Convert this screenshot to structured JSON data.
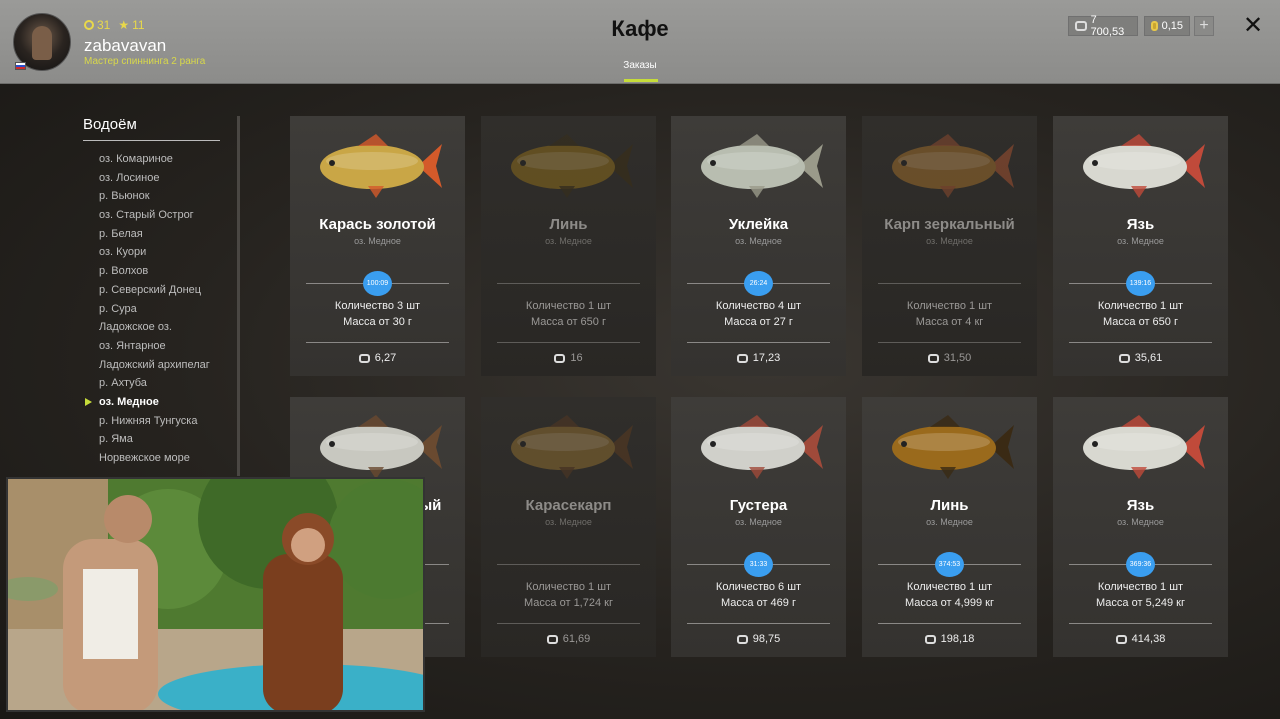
{
  "header": {
    "title": "Кафе",
    "tab": "Заказы",
    "user": {
      "name": "zabavavan",
      "rank": "Мастер спиннинга 2 ранга",
      "level": "31",
      "stars": "11"
    },
    "currency": {
      "silver": "7 700,53",
      "gold": "0,15"
    },
    "plus": "+",
    "close": "✕"
  },
  "sidebar": {
    "title": "Водоём",
    "items": [
      "оз. Комариное",
      "оз. Лосиное",
      "р. Вьюнок",
      "оз. Старый Острог",
      "р. Белая",
      "оз. Куори",
      "р. Волхов",
      "р. Северский Донец",
      "р. Сура",
      "Ладожское оз.",
      "оз. Янтарное",
      "Ладожский архипелаг",
      "р. Ахтуба",
      "оз. Медное",
      "р. Нижняя Тунгуска",
      "р. Яма",
      "Норвежское море"
    ],
    "active_index": 13
  },
  "cards": [
    {
      "name": "Карась золотой",
      "location": "оз. Медное",
      "timer": "100:09",
      "quantity": "Количество 3 шт",
      "mass": "Масса от 30 г",
      "price": "6,27",
      "dim": false,
      "color": "#c9a646",
      "tail": "#d45a2a"
    },
    {
      "name": "Линь",
      "location": "оз. Медное",
      "timer": "",
      "quantity": "Количество 1 шт",
      "mass": "Масса от 650 г",
      "price": "16",
      "dim": true,
      "color": "#8a6a1c",
      "tail": "#3a2e16"
    },
    {
      "name": "Уклейка",
      "location": "оз. Медное",
      "timer": "26:24",
      "quantity": "Количество 4 шт",
      "mass": "Масса от 27 г",
      "price": "17,23",
      "dim": false,
      "color": "#b8bdb0",
      "tail": "#9a9a8a"
    },
    {
      "name": "Карп зеркальный",
      "location": "оз. Медное",
      "timer": "",
      "quantity": "Количество 1 шт",
      "mass": "Масса от 4 кг",
      "price": "31,50",
      "dim": true,
      "color": "#9a6a2a",
      "tail": "#a05030"
    },
    {
      "name": "Язь",
      "location": "оз. Медное",
      "timer": "139:16",
      "quantity": "Количество 1 шт",
      "mass": "Масса от 650 г",
      "price": "35,61",
      "dim": false,
      "color": "#d8d8d0",
      "tail": "#c04a3a"
    },
    {
      "name": "Лещ серебряный",
      "location": "оз. Медное",
      "timer": "",
      "quantity": "",
      "mass": "",
      "price": "",
      "dim": false,
      "color": "#c8c8c0",
      "tail": "#6a4a30"
    },
    {
      "name": "Карасекарп",
      "location": "оз. Медное",
      "timer": "",
      "quantity": "Количество 1 шт",
      "mass": "Масса от 1,724 кг",
      "price": "61,69",
      "dim": true,
      "color": "#8a6a30",
      "tail": "#5a3a20"
    },
    {
      "name": "Густера",
      "location": "оз. Медное",
      "timer": "31:33",
      "quantity": "Количество 6 шт",
      "mass": "Масса от 469 г",
      "price": "98,75",
      "dim": false,
      "color": "#d0d0ca",
      "tail": "#a04a3a"
    },
    {
      "name": "Линь",
      "location": "оз. Медное",
      "timer": "374:53",
      "quantity": "Количество 1 шт",
      "mass": "Масса от 4,999 кг",
      "price": "198,18",
      "dim": false,
      "color": "#9a6a1c",
      "tail": "#3a2a14"
    },
    {
      "name": "Язь",
      "location": "оз. Медное",
      "timer": "369:36",
      "quantity": "Количество 1 шт",
      "mass": "Масса от 5,249 кг",
      "price": "414,38",
      "dim": false,
      "color": "#d8d8d0",
      "tail": "#c04a3a"
    }
  ],
  "colors": {
    "accent": "#c6dc3a",
    "timer": "#3a9ef0",
    "header": "#8c8c8a"
  }
}
